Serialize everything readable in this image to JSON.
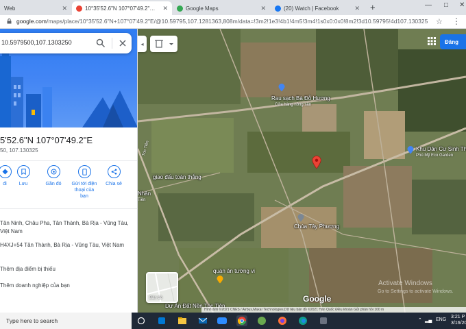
{
  "browser": {
    "tabs": [
      {
        "label": "Web",
        "active": false
      },
      {
        "label": "10°35'52.6\"N 107°07'49.2\"E - Go",
        "active": true
      },
      {
        "label": "Google Maps",
        "active": false
      },
      {
        "label": "(20) Watch | Facebook",
        "active": false
      }
    ],
    "url_host": "google.com",
    "url_rest": "/maps/place/10°35'52.6\"N+107°07'49.2\"E/@10.59795,107.1281363,808m/data=!3m2!1e3!4b1!4m5!3m4!1s0x0:0x0!8m2!3d10.59795!4d107.130325"
  },
  "panel": {
    "search_value": "10.5979500,107.1303250",
    "coord_title": "5'52.6\"N 107°07'49.2\"E",
    "coord_sub": "50, 107.130325",
    "actions": [
      {
        "label": "đi"
      },
      {
        "label": "Lưu"
      },
      {
        "label": "Gần đó"
      },
      {
        "label": "Gửi tới điện thoại của bạn"
      },
      {
        "label": "Chia sẻ"
      }
    ],
    "address": "Tân Ninh, Châu Pha, Tân Thành, Bà Rịa - Vũng Tàu, Việt Nam",
    "plus_code": "H4XJ+54 Tân Thành, Bà Rịa - Vũng Tàu, Việt Nam",
    "add_place": "Thêm địa điểm bị thiếu",
    "add_business": "Thêm doanh nghiệp của bạn"
  },
  "map": {
    "signin": "Đăng",
    "pois": [
      {
        "label": "Rau sạch Bà Đỗ Hương",
        "sub": "Cửa hàng nông sản"
      },
      {
        "label": "Khu Dân Cư Sinh Th",
        "sub": "Phú Mỹ Eco Garden"
      },
      {
        "label": "giao đấu toàn thắng",
        "sub": ""
      },
      {
        "label": "Nhân",
        "sub": "Tiền"
      },
      {
        "label": "Chùa Tây Phương",
        "sub": ""
      },
      {
        "label": "quán ăn tường vi",
        "sub": ""
      },
      {
        "label": "Dự Án Đất Nền Tóc Tiên",
        "sub": ""
      }
    ],
    "road_label": "Tóc Tiên",
    "minimap_label": "Bản đồ",
    "google": "Google",
    "footer": "Hình ảnh ©2021 CNES / Airbus,Maxar Technologies,Dữ liệu bản đồ ©2021   Hàn Quốc   Điều khoản   Gửi phản hồi   100 m",
    "activate_title": "Activate Windows",
    "activate_sub": "Go to Settings to activate Windows."
  },
  "taskbar": {
    "search_placeholder": "Type here to search",
    "lang": "ENG",
    "time": "3:21 P",
    "date": "3/16/20"
  },
  "colors": {
    "accent": "#1a73e8",
    "pin": "#ea4335",
    "hero_blue": "#4285f4",
    "taskbar": "#1f2937"
  }
}
